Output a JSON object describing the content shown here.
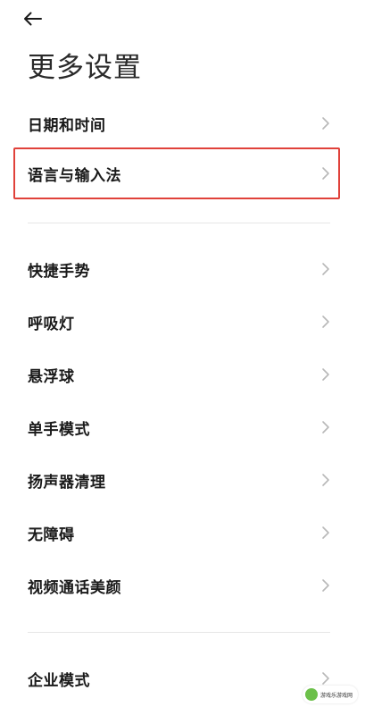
{
  "header": {
    "title": "更多设置"
  },
  "menu": {
    "group1": [
      {
        "label": "日期和时间"
      },
      {
        "label": "语言与输入法"
      }
    ],
    "group2": [
      {
        "label": "快捷手势"
      },
      {
        "label": "呼吸灯"
      },
      {
        "label": "悬浮球"
      },
      {
        "label": "单手模式"
      },
      {
        "label": "扬声器清理"
      },
      {
        "label": "无障碍"
      },
      {
        "label": "视频通话美颜"
      }
    ],
    "group3": [
      {
        "label": "企业模式"
      }
    ]
  },
  "watermark": {
    "text": "游戏乐游戏网"
  },
  "colors": {
    "highlight_border": "#e0413a",
    "chevron": "#b8b8b8",
    "divider": "#e6e6e6"
  },
  "icons": {
    "back": "arrow-left-icon",
    "chevron": "chevron-right-icon"
  }
}
